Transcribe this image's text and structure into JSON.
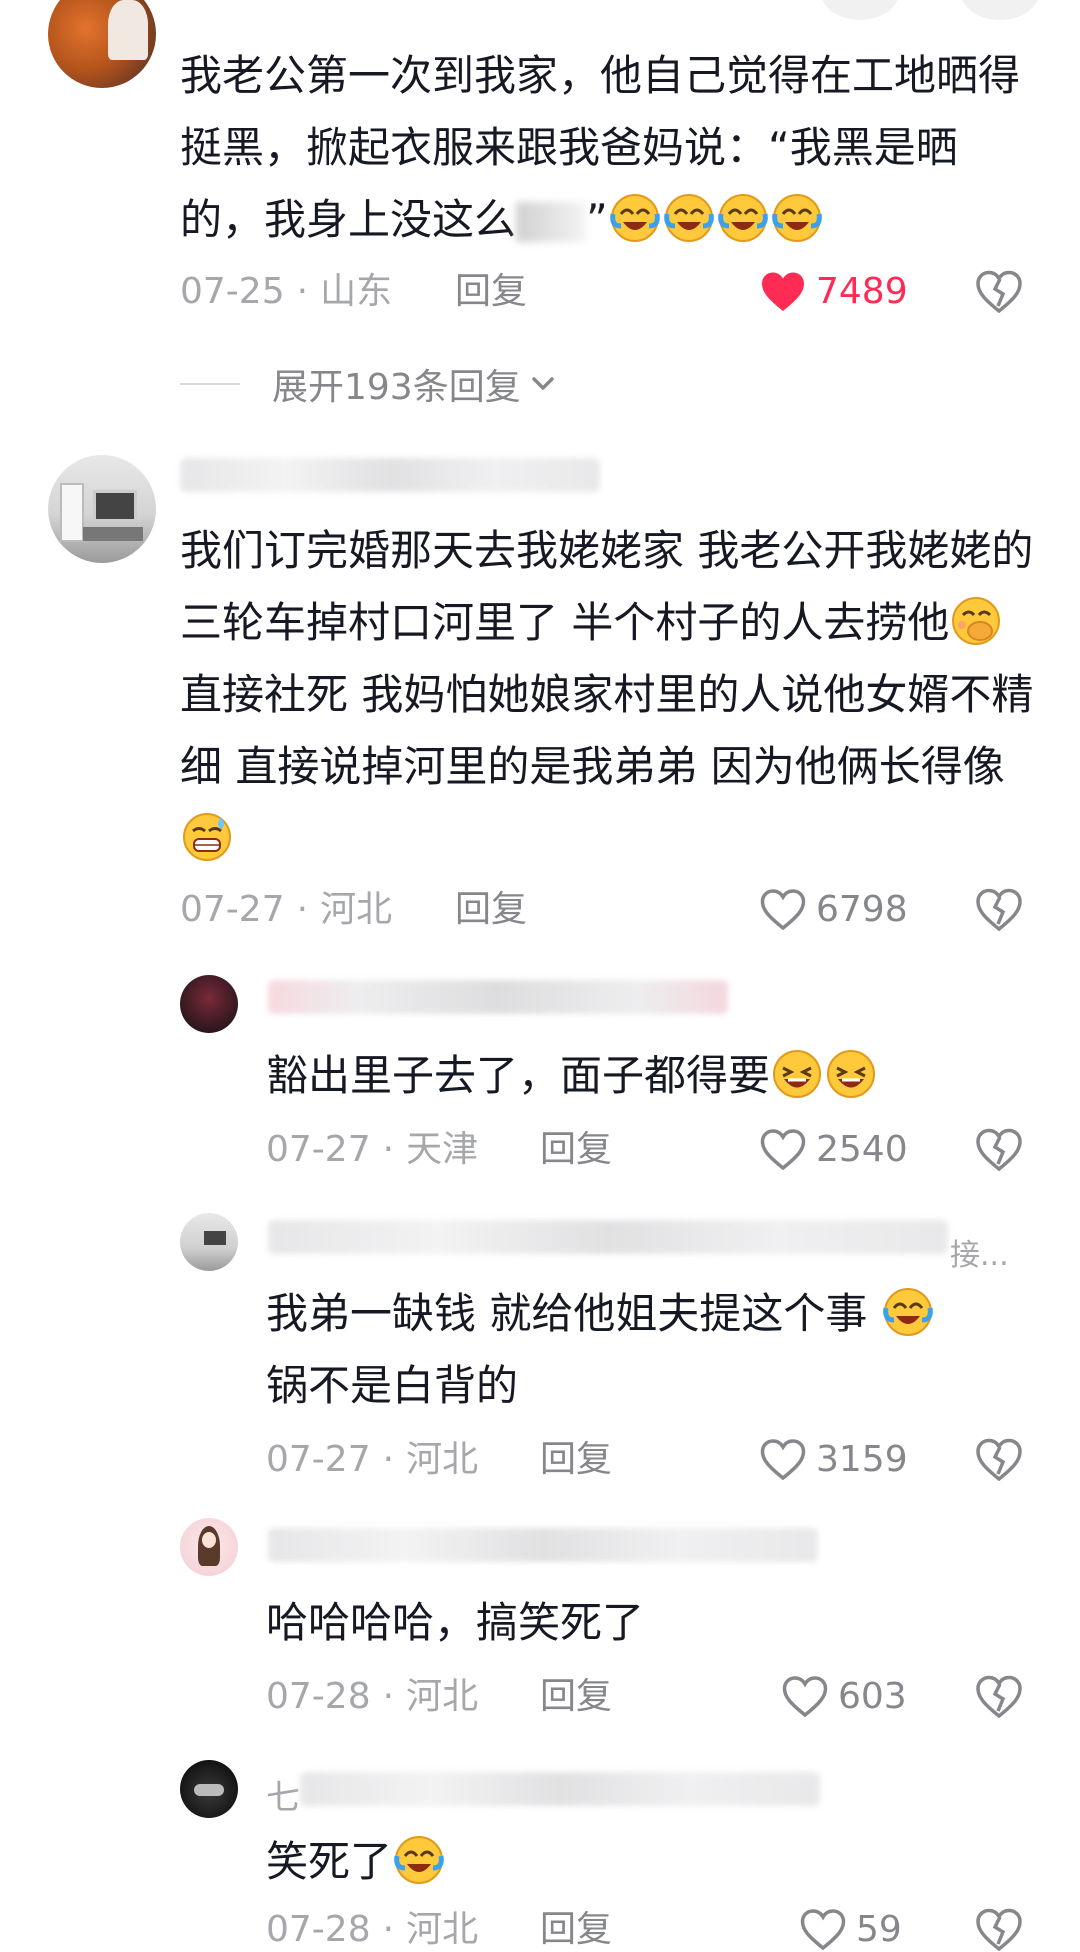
{
  "comments": [
    {
      "text_before": "我老公第一次到我家，他自己觉得在工地晒得挺黑，掀起衣服来跟我爸妈说：“我黑是晒的，我身上没这么",
      "text_emoji_tail": "”",
      "date": "07-25",
      "location": "山东",
      "reply": "回复",
      "likes": "7489",
      "liked": true,
      "expand_label": "展开193条回复"
    },
    {
      "text_part1": "我们订完婚那天去我姥姥家 我老公开我姥姥的三轮车掉村口河里了 半个村子的人去捞他",
      "text_part2": " 直接社死 我妈怕她娘家村里的人说他女婿不精细 直接说掉河里的是我弟弟 因为他俩长得像",
      "date": "07-27",
      "location": "河北",
      "reply": "回复",
      "likes": "6798"
    }
  ],
  "replies": [
    {
      "text": "豁出里子去了，面子都得要",
      "date": "07-27",
      "location": "天津",
      "reply": "回复",
      "likes": "2540"
    },
    {
      "name_suffix": "接...",
      "text": "我弟一缺钱 就给他姐夫提这个事 ",
      "text_line2": "锅不是白背的",
      "date": "07-27",
      "location": "河北",
      "reply": "回复",
      "likes": "3159"
    },
    {
      "text": "哈哈哈哈，搞笑死了",
      "date": "07-28",
      "location": "河北",
      "reply": "回复",
      "likes": "603"
    },
    {
      "name_prefix": "七",
      "text": "笑死了",
      "date": "07-28",
      "location": "河北",
      "reply": "回复",
      "likes": "59"
    }
  ],
  "icons": {
    "like": "heart-outline",
    "liked": "heart-filled",
    "dislike": "broken-heart",
    "expand": "chevron-down"
  },
  "colors": {
    "liked": "#fe2c55",
    "meta": "#a6a7ab"
  }
}
